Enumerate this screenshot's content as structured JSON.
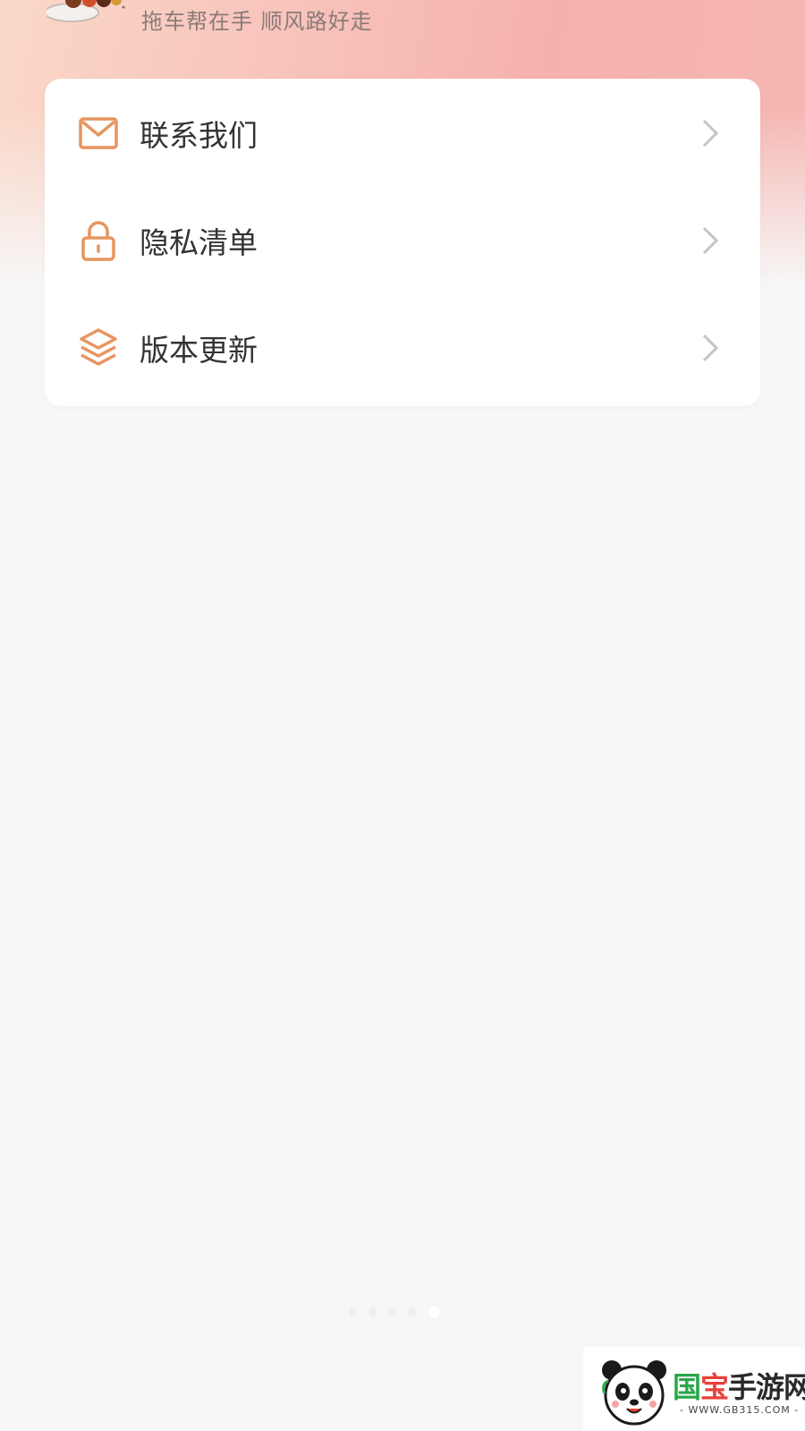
{
  "header": {
    "tagline": "拖车帮在手 顺风路好走"
  },
  "menu": {
    "items": [
      {
        "label": "联系我们",
        "icon": "mail-icon"
      },
      {
        "label": "隐私清单",
        "icon": "lock-icon"
      },
      {
        "label": "版本更新",
        "icon": "layers-icon"
      }
    ]
  },
  "pager": {
    "count": 5,
    "active_index": 4
  },
  "watermark": {
    "title_part1": "国",
    "title_part2": "宝",
    "title_part3": "手游网",
    "url": "- WWW.GB315.COM -"
  },
  "colors": {
    "accent_icon": "#e7955f",
    "label_text": "#333333",
    "chevron": "#c4c4c4",
    "background": "#f7f7f7"
  }
}
